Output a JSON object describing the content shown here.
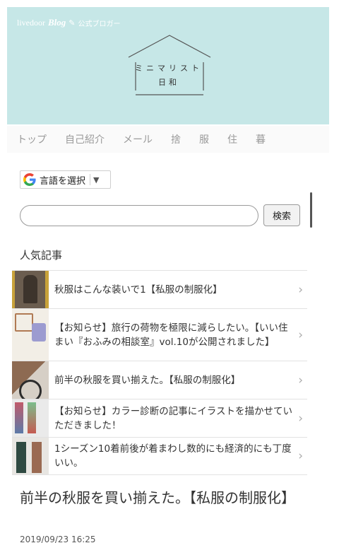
{
  "header": {
    "brand_livedoor": "livedoor",
    "brand_blog": "Blog",
    "brand_official": "公式ブロガー",
    "logo_line1": "ミニマリスト",
    "logo_line2": "日和",
    "background_color": "#c6e7e7"
  },
  "nav": {
    "items": [
      "トップ",
      "自己紹介",
      "メール",
      "捨",
      "服",
      "住",
      "暮"
    ]
  },
  "translate": {
    "label": "言語を選択",
    "arrow": "▼",
    "icon": "google-g-icon"
  },
  "search": {
    "value": "",
    "placeholder": "",
    "button_label": "検索"
  },
  "popular": {
    "title": "人気記事",
    "items": [
      {
        "text": "秋服はこんな装いで1【私服の制服化】"
      },
      {
        "text": "【お知らせ】旅行の荷物を極限に減らしたい。【いい住まい『おふみの相談室』vol.10が公開されました】"
      },
      {
        "text": "前半の秋服を買い揃えた。【私服の制服化】"
      },
      {
        "text": "【お知らせ】カラー診断の記事にイラストを描かせていただきました！"
      },
      {
        "text": "1シーズン10着前後が着まわし数的にも経済的にも丁度いい。"
      }
    ]
  },
  "article": {
    "title": "前半の秋服を買い揃えた。【私服の制服化】",
    "date": "2019/09/23 16:25"
  }
}
